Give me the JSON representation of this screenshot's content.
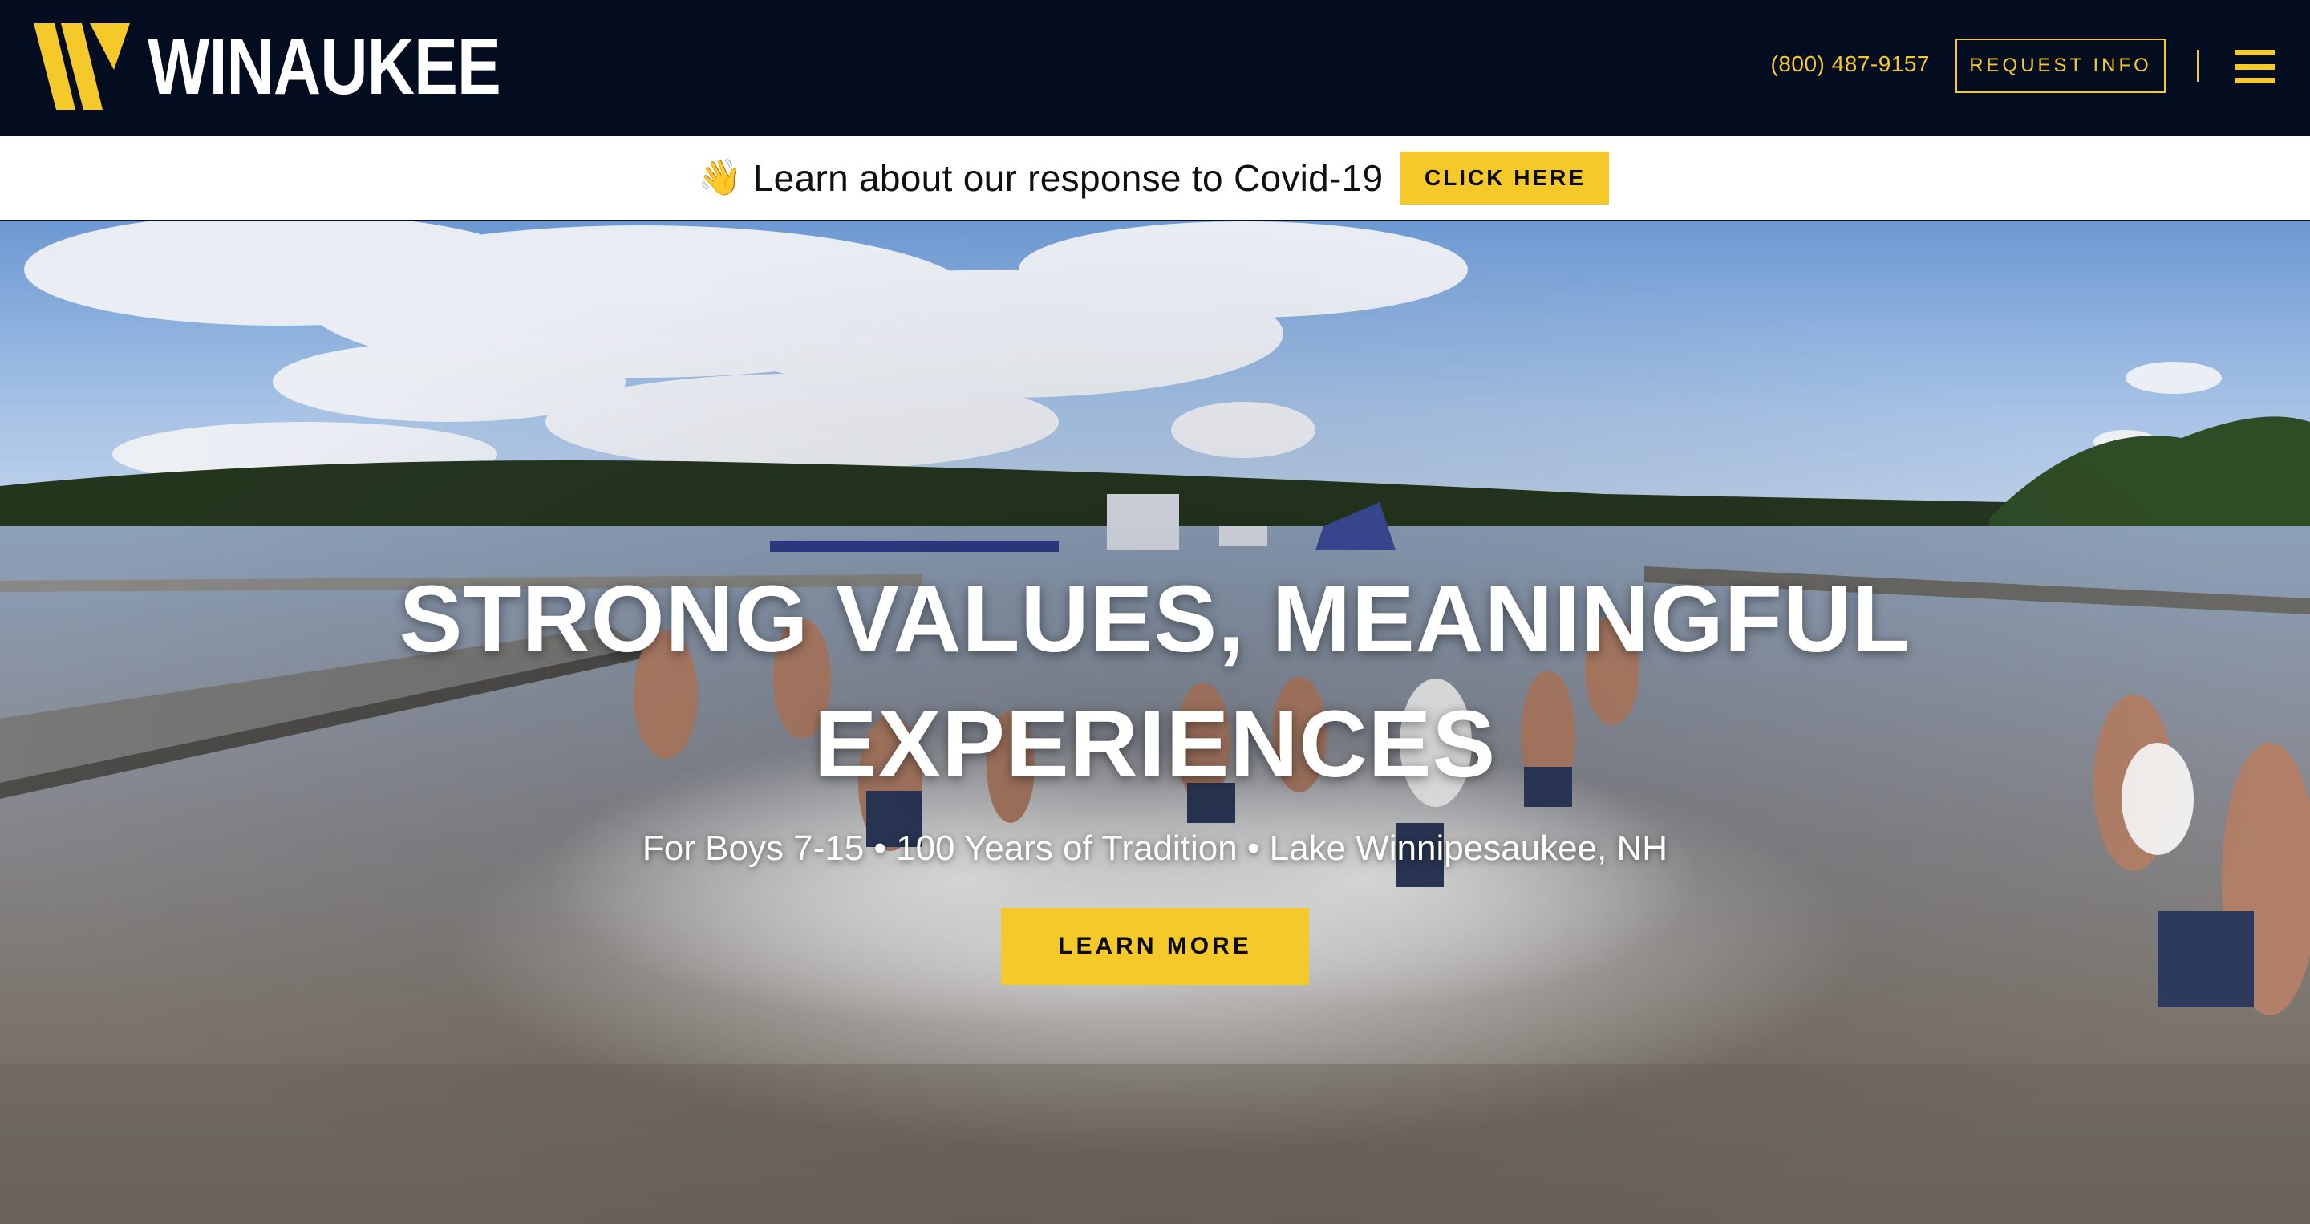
{
  "header": {
    "logo_text": "WINAUKEE",
    "phone": "(800) 487-9157",
    "request_label": "REQUEST INFO"
  },
  "banner": {
    "emoji": "👋",
    "text": "Learn about our response to Covid-19",
    "button_label": "CLICK HERE"
  },
  "hero": {
    "title_line1": "STRONG VALUES, MEANINGFUL",
    "title_line2": "EXPERIENCES",
    "subtitle": "For Boys 7-15 • 100 Years of Tradition • Lake Winnipesaukee, NH",
    "button_label": "LEARN MORE"
  },
  "colors": {
    "header_bg": "#040d1f",
    "accent": "#f6c92b",
    "banner_bg": "#ffffff"
  },
  "icons": [
    "winaukee-logo-mark",
    "wave-icon",
    "menu-icon"
  ]
}
